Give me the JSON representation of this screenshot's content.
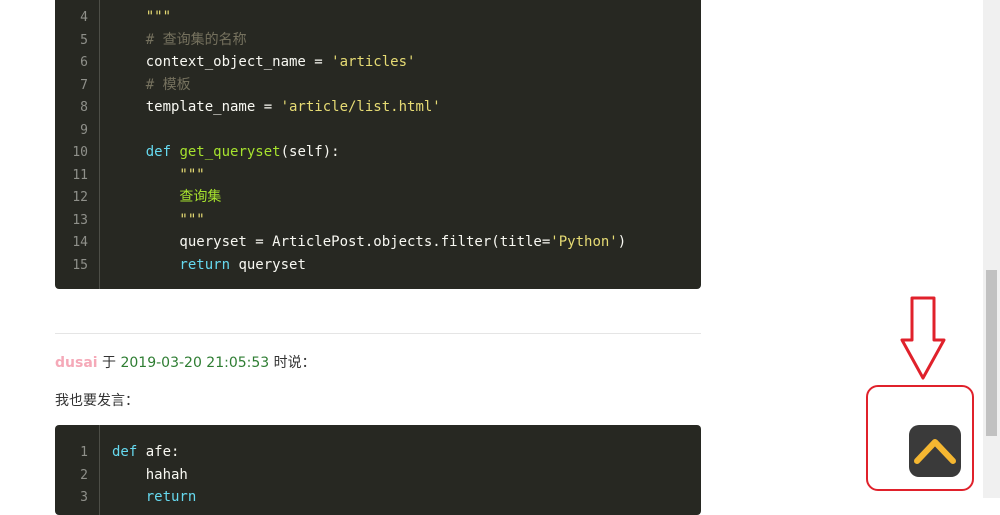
{
  "code_block_1": {
    "lines": [
      {
        "n": "4",
        "segs": [
          [
            "t-doc",
            "    \"\"\""
          ]
        ]
      },
      {
        "n": "5",
        "segs": [
          [
            "t-cmt",
            "    # 查询集的名称"
          ]
        ]
      },
      {
        "n": "6",
        "segs": [
          [
            "t-txt",
            "    context_object_name = "
          ],
          [
            "t-sstr",
            "'articles'"
          ]
        ]
      },
      {
        "n": "7",
        "segs": [
          [
            "t-cmt",
            "    # 模板"
          ]
        ]
      },
      {
        "n": "8",
        "segs": [
          [
            "t-txt",
            "    template_name = "
          ],
          [
            "t-sstr",
            "'article/list.html'"
          ]
        ]
      },
      {
        "n": "9",
        "segs": [
          [
            "t-txt",
            ""
          ]
        ]
      },
      {
        "n": "10",
        "segs": [
          [
            "t-kw",
            "    def "
          ],
          [
            "t-fn",
            "get_queryset"
          ],
          [
            "t-txt",
            "(self):"
          ]
        ]
      },
      {
        "n": "11",
        "segs": [
          [
            "t-doc",
            "        \"\"\""
          ]
        ]
      },
      {
        "n": "12",
        "segs": [
          [
            "t-str",
            "        查询集"
          ]
        ]
      },
      {
        "n": "13",
        "segs": [
          [
            "t-doc",
            "        \"\"\""
          ]
        ]
      },
      {
        "n": "14",
        "segs": [
          [
            "t-txt",
            "        queryset = ArticlePost.objects.filter(title="
          ],
          [
            "t-sstr",
            "'Python'"
          ],
          [
            "t-txt",
            ")"
          ]
        ]
      },
      {
        "n": "15",
        "segs": [
          [
            "t-kw",
            "        return"
          ],
          [
            "t-txt",
            " queryset"
          ]
        ]
      }
    ]
  },
  "comment": {
    "author": "dusai",
    "yu": " 于 ",
    "datetime": "2019-03-20 21:05:53",
    "said": " 时说：",
    "body": "我也要发言："
  },
  "code_block_2": {
    "lines": [
      {
        "n": "1",
        "segs": [
          [
            "t-kw",
            "def "
          ],
          [
            "t-txt",
            "afe:"
          ]
        ]
      },
      {
        "n": "2",
        "segs": [
          [
            "t-txt",
            "    hahah"
          ]
        ]
      },
      {
        "n": "3",
        "segs": [
          [
            "t-kw",
            "    return"
          ]
        ]
      }
    ]
  },
  "back_to_top": {
    "icon": "chevron-up-icon",
    "accent": "#f5b731"
  },
  "annotation_color": "#e0212b"
}
